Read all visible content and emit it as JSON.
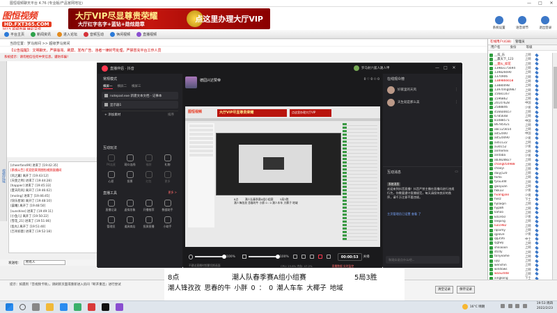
{
  "app": {
    "title": "图恒视频聊天平台 4.76 (专业版/产品官网地址)",
    "window_controls": [
      "—",
      "□",
      "✕"
    ],
    "logo": {
      "name": "图恒视频",
      "url": "HD.FXT365.COM",
      "slogan": "2013 视频直播 精彩呈现"
    },
    "vip_banner": {
      "title": "大厅VIP尽显尊贵荣耀",
      "sub": "大厅红字名字+蓝钻+勋炫勋章",
      "right": "点这里办理大厅VIP"
    },
    "top_right": [
      {
        "label": "系统设置",
        "icon": "gear-icon"
      },
      {
        "label": "语音调节",
        "icon": "speaker-icon"
      },
      {
        "label": "退出登录",
        "icon": "exit-icon"
      }
    ],
    "toolbar": [
      {
        "label": "平台主页",
        "color": "#2c7ad8"
      },
      {
        "label": "新闻资讯",
        "color": "#2fa24c"
      },
      {
        "label": "进入论坛",
        "color": "#e38a1d"
      },
      {
        "label": "音频互动",
        "color": "#d6333a"
      },
      {
        "label": "休闲视频",
        "color": "#2c7ad8"
      },
      {
        "label": "直播视频",
        "color": "#8a4fd0"
      }
    ],
    "breadcrumb": "当前位置：罗马房间 >> 超级罗马房间",
    "notice1": "【公告提醒】：文明聊天，严禁辱骂、刷屏、发布广告、违者一律封号处理，严禁冒充平台工作人员",
    "notice2": "系统提示：请勿相信任何中奖信息，谨防诈骗！",
    "side_tab": "视频区域",
    "chat_lines": [
      {
        "text": "[cheerfans99] 进来了 [19:42:35]",
        "red": false
      },
      {
        "text": "[系统公告] 欢迎您来到图恒视频直播间",
        "red": true
      },
      {
        "text": "[风之翼] 离开了 [19:43:12]",
        "red": false
      },
      {
        "text": "[天使之吻] 进来了 [19:44:28]",
        "red": false
      },
      {
        "text": "[happier] 进来了 [19:45:33]",
        "red": false
      },
      {
        "text": "[夏天的风] 离开了 [19:46:02]",
        "red": false
      },
      {
        "text": "[moling] 进来了 [19:46:45]",
        "red": false
      },
      {
        "text": "[快乐星球] 离开了 [19:48:10]",
        "red": false
      },
      {
        "text": "[晨曦] 离开了 [19:48:50]",
        "red": false
      },
      {
        "text": "[sunshine] 进来了 [19:49:11]",
        "red": false
      },
      {
        "text": "[小鱼儿] 离开了 [19:50:22]",
        "red": false
      },
      {
        "text": "[雪花_21] 进来了 [19:51:06]",
        "red": false
      },
      {
        "text": "[鱼丸] 离开了 [19:51:40]",
        "red": false
      },
      {
        "text": "[吉祥如意] 进来了 [19:52:18]",
        "red": false
      }
    ],
    "chat_target_label": "发送给：",
    "chat_target_value": "所有人",
    "bottom_tip": "提示：如遇到『音视频卡顿』，请刷新页面或重新进入房间『断开重连』进行尝试",
    "bottom_buttons": [
      "清空记录",
      "保存记录"
    ],
    "userpanel": {
      "tabs": [
        "在线用户(438)",
        "管理员"
      ],
      "active_tab": 0,
      "headers": [
        "用户名",
        "身份",
        "等级"
      ],
      "users": [
        {
          "name": "__炫_乐",
          "role": "上网",
          "red": false
        },
        {
          "name": "__赢天下_123",
          "role": "上网",
          "red": false
        },
        {
          "name": "__烟火_如花",
          "role": "上网",
          "red": true
        },
        {
          "name": "13983175694",
          "role": "上网",
          "red": false
        },
        {
          "name": "139826690",
          "role": "上网",
          "red": false
        },
        {
          "name": "1370906",
          "role": "上网",
          "red": false
        },
        {
          "name": "1389866658",
          "role": "上网",
          "red": true
        },
        {
          "name": "13880098",
          "role": "上网",
          "red": false
        },
        {
          "name": "13970lng0987",
          "role": "上网",
          "red": false
        },
        {
          "name": "15681167",
          "role": "上网",
          "red": false
        },
        {
          "name": "1596862",
          "role": "上网",
          "red": false
        },
        {
          "name": "20147628",
          "role": "中国",
          "red": false
        },
        {
          "name": "2588846",
          "role": "少将",
          "red": false
        },
        {
          "name": "456600657",
          "role": "上网",
          "red": false
        },
        {
          "name": "6785648",
          "role": "上网",
          "red": false
        },
        {
          "name": "81088571",
          "role": "中国",
          "red": false
        },
        {
          "name": "86785421",
          "role": "上网",
          "red": false
        },
        {
          "name": "abc125654",
          "role": "上网",
          "red": false
        },
        {
          "name": "ad52000",
          "role": "中国",
          "red": false
        },
        {
          "name": "ad520090",
          "role": "少将",
          "red": false
        },
        {
          "name": "aidi1122",
          "role": "上网",
          "red": false
        },
        {
          "name": "ai30152",
          "role": "少将",
          "red": false
        },
        {
          "name": "anmemei",
          "role": "上网",
          "red": false
        },
        {
          "name": "andaba",
          "role": "少将",
          "red": false
        },
        {
          "name": "ab3828827",
          "role": "上网",
          "red": false
        },
        {
          "name": "chang050988",
          "role": "上网",
          "red": true
        },
        {
          "name": "chaoyi",
          "role": "上网",
          "red": false
        },
        {
          "name": "daiyj520",
          "role": "上网",
          "red": false
        },
        {
          "name": "feifei",
          "role": "上网",
          "red": false
        },
        {
          "name": "fyou3dd",
          "role": "上网",
          "red": false
        },
        {
          "name": "gaoyuan",
          "role": "上网",
          "red": false
        },
        {
          "name": "hkk33",
          "role": "少将",
          "red": false
        },
        {
          "name": "huangjiao",
          "role": "少将",
          "red": true
        },
        {
          "name": "hxsz",
          "role": "下士",
          "red": false
        },
        {
          "name": "hylaiqin",
          "role": "上网",
          "red": false
        },
        {
          "name": "hyp8h",
          "role": "上网",
          "red": false
        },
        {
          "name": "kahoo",
          "role": "上网",
          "red": false
        },
        {
          "name": "kd1950",
          "role": "少将",
          "red": false
        },
        {
          "name": "leeping",
          "role": "上网",
          "red": false
        },
        {
          "name": "luo1982",
          "role": "上网",
          "red": true
        },
        {
          "name": "rqsxmy",
          "role": "上网",
          "red": false
        },
        {
          "name": "qplove",
          "role": "少将",
          "red": false
        },
        {
          "name": "qq35fo",
          "role": "中士",
          "red": false
        },
        {
          "name": "sjglwy",
          "role": "上网",
          "red": false
        },
        {
          "name": "shiliaoon",
          "role": "上网",
          "red": false
        },
        {
          "name": "stcdy",
          "role": "上网",
          "red": false
        },
        {
          "name": "tonyeame",
          "role": "上网",
          "red": false
        },
        {
          "name": "uyy",
          "role": "上网",
          "red": false
        },
        {
          "name": "wenshin",
          "role": "上网",
          "red": false
        },
        {
          "name": "windows",
          "role": "上网",
          "red": false
        },
        {
          "name": "woai2008",
          "role": "上网",
          "red": true
        },
        {
          "name": "xingkong",
          "role": "下士",
          "red": false
        }
      ]
    }
  },
  "obs": {
    "app_name": "直播伴侣 · 抖音",
    "user_name": "罗马射六狐人路人甲",
    "window_controls": [
      "—",
      "□",
      "✕"
    ],
    "scene_section": "常规模式",
    "scene_tabs": [
      "横屏一",
      "横屏二",
      "横屏三"
    ],
    "active_scene": 0,
    "sources": [
      {
        "label": "notepad.exe 新建文本文档 - 记事本"
      },
      {
        "label": "显示器1"
      }
    ],
    "add_source": "+ 添加素材",
    "add_source_right": "排序",
    "interact_section": "互动玩法",
    "interact_items": [
      {
        "label": "PK连麦",
        "dim": true
      },
      {
        "label": "观众连线",
        "dim": false
      },
      {
        "label": "福袋",
        "dim": true
      },
      {
        "label": "礼物",
        "dim": false
      },
      {
        "label": "心愿",
        "dim": false
      },
      {
        "label": "投票",
        "dim": false
      },
      {
        "label": "红包",
        "dim": true
      },
      {
        "label": "更多",
        "dim": true
      }
    ],
    "tools_section": "直播工具",
    "tools_more": "更多 >",
    "tools_items": [
      {
        "label": "直播记录"
      },
      {
        "label": "虚拟形象"
      },
      {
        "label": "开播推荐"
      },
      {
        "label": "数据助手"
      },
      {
        "label": "管理员"
      },
      {
        "label": "道具商店"
      },
      {
        "label": "投屏直播"
      },
      {
        "label": "小助手"
      }
    ],
    "stream_title": "德园兴达赞帝",
    "stats": "0 ♡  0  ⚇  0",
    "mic_percent": "100%",
    "speaker_percent": "100%",
    "mic_level": 1.0,
    "speaker_level": 1.0,
    "timer": "00:00:53",
    "end_label": "关播",
    "status_text": "CPU: 23.8%    内存: 47.2%",
    "status_live": "直播数据 实时监控",
    "foot_text": "不建议直播时频繁切换画面",
    "audience_section": "在线观众榜",
    "audience": [
      {
        "name": "好家里的天风"
      },
      {
        "name": "天生就是那么美"
      }
    ],
    "messages_section": "互动消息",
    "sysmsg_tag": "系统消息",
    "sysmsg_text": "欢迎来到抖音直播！抖音严禁主播在直播间进行违规行为，你需要遵守直播规范，每天请保持良好的秩序，请千万注意不要违规。",
    "sysmsg_link": "主页管理员已设置 查看 了",
    "input_placeholder": "和观众说点什么吧..."
  },
  "preview": {
    "logo": "图恒视频",
    "banner": "大厅VIP尽显尊贵荣耀",
    "banner_right": "点这里办理大厅VIP",
    "caption": "8点        潮人队春季赛A组小组赛        5局3胜\n潮人锋孜孜 思春的牛 小胖 0 : 0 潮人车车 大椰子 地域"
  },
  "subtitle": {
    "line1_time": "8点",
    "line1_title": "潮人队春季赛A组小组赛",
    "line1_right": "5局3胜",
    "line2": "潮人锋孜孜 思春的牛 小胖 0 ： 0 潮人车车 大椰子 地域"
  },
  "taskbar": {
    "weather": "16°C 晴朗",
    "time": "19:53",
    "weekday": "周四",
    "date": "2022/2/23"
  }
}
